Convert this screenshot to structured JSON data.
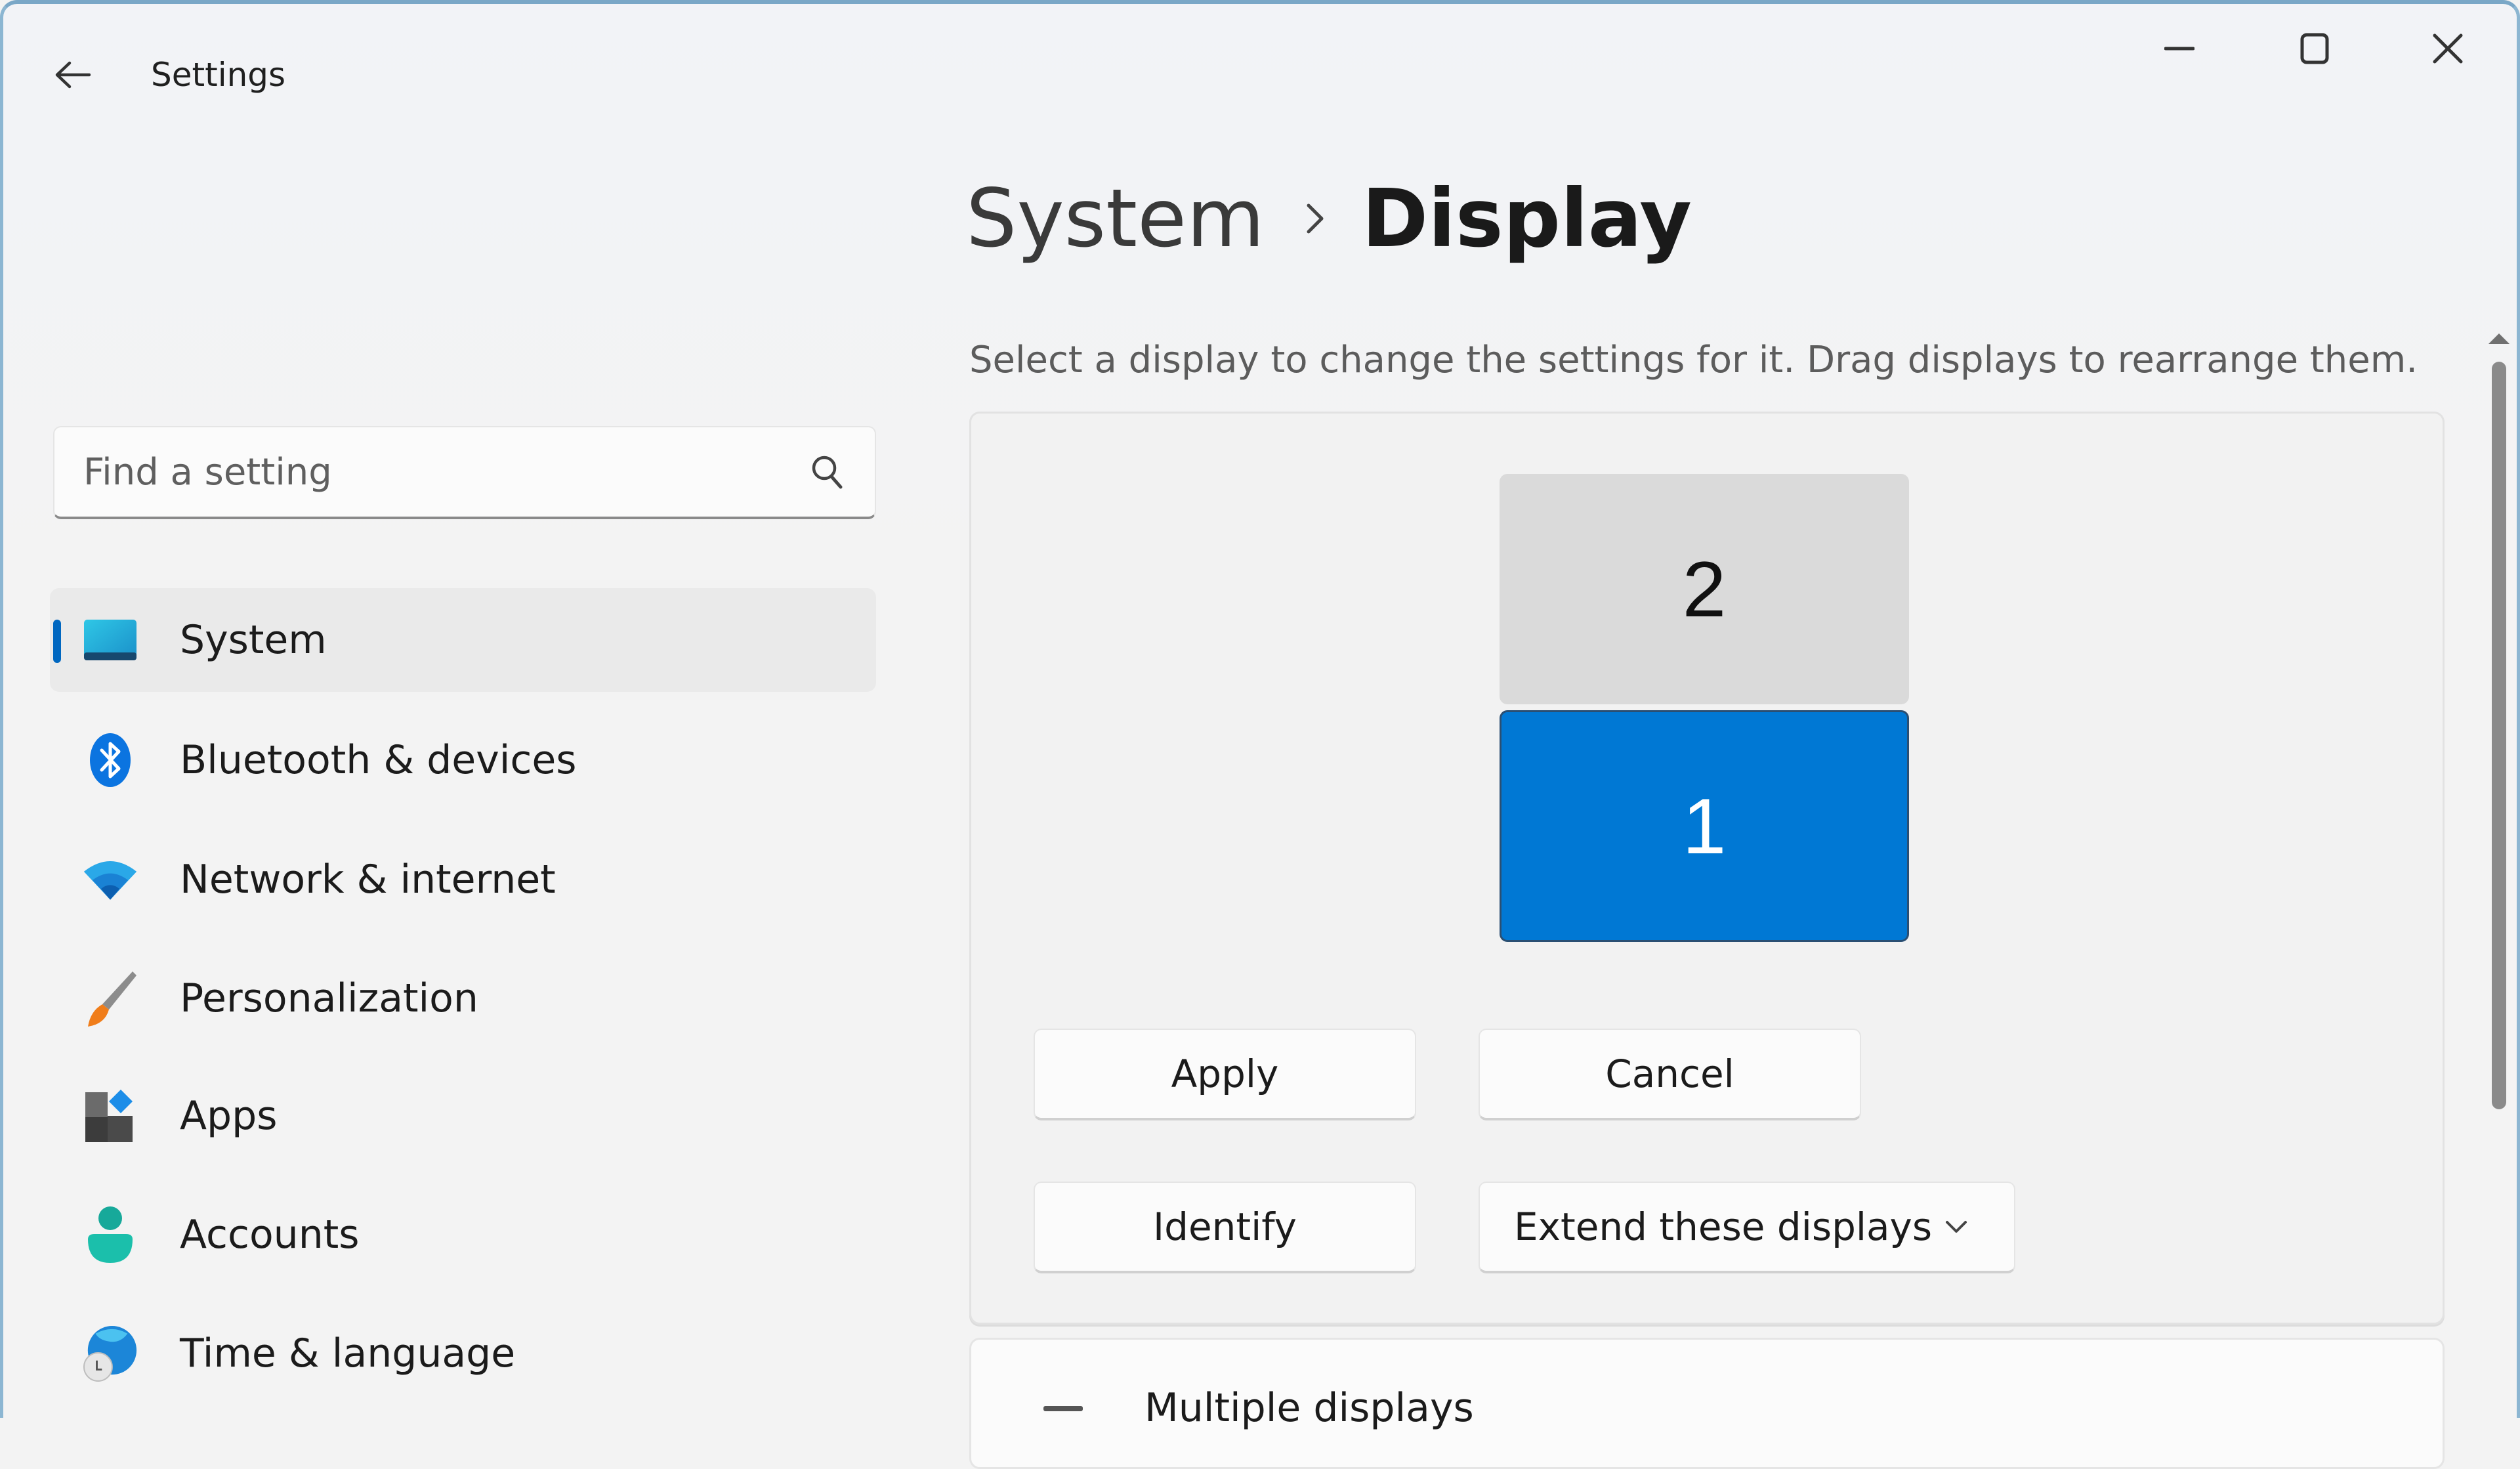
{
  "window": {
    "title": "Settings",
    "controls": {
      "minimize": "minimize",
      "maximize": "maximize",
      "close": "close"
    }
  },
  "search": {
    "placeholder": "Find a setting",
    "value": ""
  },
  "sidebar": {
    "selected_index": 0,
    "items": [
      {
        "label": "System",
        "icon": "monitor-icon"
      },
      {
        "label": "Bluetooth & devices",
        "icon": "bluetooth-icon"
      },
      {
        "label": "Network & internet",
        "icon": "wifi-icon"
      },
      {
        "label": "Personalization",
        "icon": "paintbrush-icon"
      },
      {
        "label": "Apps",
        "icon": "apps-icon"
      },
      {
        "label": "Accounts",
        "icon": "person-icon"
      },
      {
        "label": "Time & language",
        "icon": "globe-clock-icon"
      }
    ]
  },
  "header": {
    "breadcrumb_parent": "System",
    "breadcrumb_separator": "›",
    "page_title": "Display",
    "subtitle": "Select a display to change the settings for it. Drag displays to rearrange them."
  },
  "arrangement": {
    "displays": [
      {
        "id": "2",
        "selected": false
      },
      {
        "id": "1",
        "selected": true
      }
    ],
    "colors": {
      "selected": "#0078d4",
      "unselected": "#dadada"
    }
  },
  "buttons": {
    "apply": "Apply",
    "cancel": "Cancel",
    "identify": "Identify"
  },
  "projection_mode": {
    "selected": "Extend these displays"
  },
  "sections": {
    "multiple_displays": "Multiple displays"
  },
  "accent_color": "#0067c0"
}
